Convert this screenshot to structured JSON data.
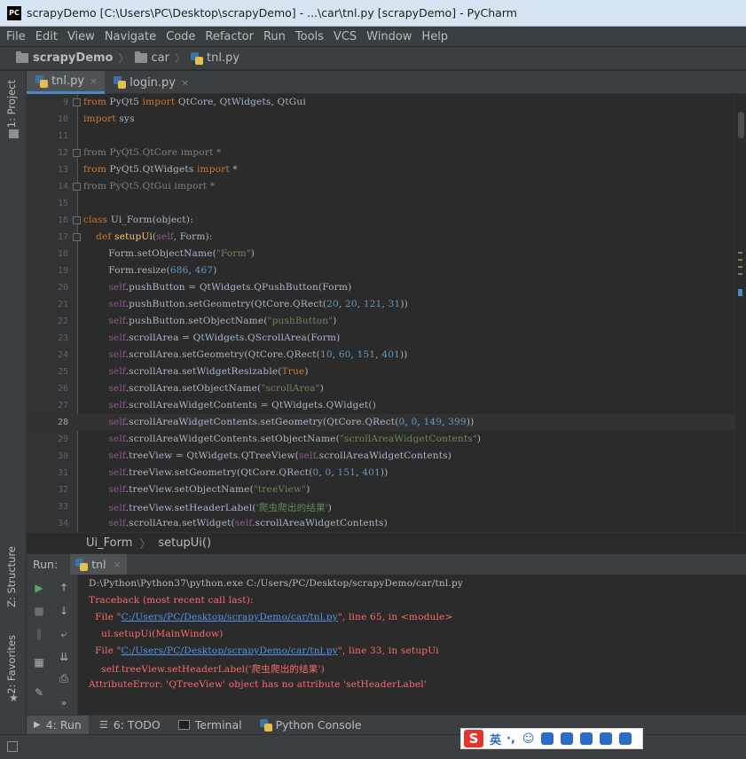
{
  "window": {
    "app_icon": "PC",
    "title": "scrapyDemo [C:\\Users\\PC\\Desktop\\scrapyDemo] - ...\\car\\tnl.py [scrapyDemo] - PyCharm"
  },
  "menu": [
    "File",
    "Edit",
    "View",
    "Navigate",
    "Code",
    "Refactor",
    "Run",
    "Tools",
    "VCS",
    "Window",
    "Help"
  ],
  "breadcrumb": {
    "project": "scrapyDemo",
    "folder": "car",
    "file": "tnl.py"
  },
  "left_strip": {
    "project_tab": "1: Project",
    "structure_tab": "Z: Structure",
    "favorites_tab": "2: Favorites"
  },
  "editor_tabs": [
    {
      "label": "tnl.py",
      "close": "×",
      "active": true
    },
    {
      "label": "login.py",
      "close": "×",
      "active": false
    }
  ],
  "editor": {
    "current_line": 28,
    "lines": [
      {
        "n": "9",
        "tokens": [
          [
            "kw",
            "from "
          ],
          [
            "t",
            "PyQt5 "
          ],
          [
            "kw",
            "import "
          ],
          [
            "t",
            "QtCore, QtWidgets, QtGui"
          ]
        ]
      },
      {
        "n": "10",
        "tokens": [
          [
            "kw",
            "import "
          ],
          [
            "t",
            "sys"
          ]
        ]
      },
      {
        "n": "11",
        "tokens": []
      },
      {
        "n": "12",
        "tokens": [
          [
            "gray",
            "from PyQt5.QtCore import *"
          ]
        ]
      },
      {
        "n": "13",
        "tokens": [
          [
            "kw",
            "from "
          ],
          [
            "t",
            "PyQt5.QtWidgets "
          ],
          [
            "kw",
            "import "
          ],
          [
            "t",
            "*"
          ]
        ]
      },
      {
        "n": "14",
        "tokens": [
          [
            "gray",
            "from PyQt5.QtGui import *"
          ]
        ]
      },
      {
        "n": "15",
        "tokens": []
      },
      {
        "n": "16",
        "tokens": [
          [
            "kw",
            "class "
          ],
          [
            "t",
            "Ui_Form(object):"
          ]
        ]
      },
      {
        "n": "17",
        "tokens": [
          [
            "t",
            "    "
          ],
          [
            "kw",
            "def "
          ],
          [
            "fn",
            "setupUi"
          ],
          [
            "t",
            "("
          ],
          [
            "self",
            "self"
          ],
          [
            "t",
            ", Form):"
          ]
        ]
      },
      {
        "n": "18",
        "tokens": [
          [
            "t",
            "        Form.setObjectName("
          ],
          [
            "str",
            "\"Form\""
          ],
          [
            "t",
            ")"
          ]
        ]
      },
      {
        "n": "19",
        "tokens": [
          [
            "t",
            "        Form.resize("
          ],
          [
            "num",
            "686"
          ],
          [
            "t",
            ", "
          ],
          [
            "num",
            "467"
          ],
          [
            "t",
            ")"
          ]
        ]
      },
      {
        "n": "20",
        "tokens": [
          [
            "t",
            "        "
          ],
          [
            "self",
            "self"
          ],
          [
            "t",
            ".pushButton = QtWidgets.QPushButton(Form)"
          ]
        ]
      },
      {
        "n": "21",
        "tokens": [
          [
            "t",
            "        "
          ],
          [
            "self",
            "self"
          ],
          [
            "t",
            ".pushButton.setGeometry(QtCore.QRect("
          ],
          [
            "num",
            "20"
          ],
          [
            "t",
            ", "
          ],
          [
            "num",
            "20"
          ],
          [
            "t",
            ", "
          ],
          [
            "num",
            "121"
          ],
          [
            "t",
            ", "
          ],
          [
            "num",
            "31"
          ],
          [
            "t",
            "))"
          ]
        ]
      },
      {
        "n": "22",
        "tokens": [
          [
            "t",
            "        "
          ],
          [
            "self",
            "self"
          ],
          [
            "t",
            ".pushButton.setObjectName("
          ],
          [
            "str",
            "\"pushButton\""
          ],
          [
            "t",
            ")"
          ]
        ]
      },
      {
        "n": "23",
        "tokens": [
          [
            "t",
            "        "
          ],
          [
            "self",
            "self"
          ],
          [
            "t",
            ".scrollArea = QtWidgets.QScrollArea(Form)"
          ]
        ]
      },
      {
        "n": "24",
        "tokens": [
          [
            "t",
            "        "
          ],
          [
            "self",
            "self"
          ],
          [
            "t",
            ".scrollArea.setGeometry(QtCore.QRect("
          ],
          [
            "num",
            "10"
          ],
          [
            "t",
            ", "
          ],
          [
            "num",
            "60"
          ],
          [
            "t",
            ", "
          ],
          [
            "num",
            "151"
          ],
          [
            "t",
            ", "
          ],
          [
            "num",
            "401"
          ],
          [
            "t",
            "))"
          ]
        ]
      },
      {
        "n": "25",
        "tokens": [
          [
            "t",
            "        "
          ],
          [
            "self",
            "self"
          ],
          [
            "t",
            ".scrollArea.setWidgetResizable("
          ],
          [
            "kw",
            "True"
          ],
          [
            "t",
            ")"
          ]
        ]
      },
      {
        "n": "26",
        "tokens": [
          [
            "t",
            "        "
          ],
          [
            "self",
            "self"
          ],
          [
            "t",
            ".scrollArea.setObjectName("
          ],
          [
            "str",
            "\"scrollArea\""
          ],
          [
            "t",
            ")"
          ]
        ]
      },
      {
        "n": "27",
        "tokens": [
          [
            "t",
            "        "
          ],
          [
            "self",
            "self"
          ],
          [
            "t",
            ".scrollAreaWidgetContents = QtWidgets.QWidget()"
          ]
        ]
      },
      {
        "n": "28",
        "tokens": [
          [
            "t",
            "        "
          ],
          [
            "self",
            "self"
          ],
          [
            "t",
            ".scrollAreaWidgetContents.setGeometry(QtCore.QRect("
          ],
          [
            "num",
            "0"
          ],
          [
            "t",
            ", "
          ],
          [
            "num",
            "0"
          ],
          [
            "t",
            ", "
          ],
          [
            "num",
            "149"
          ],
          [
            "t",
            ", "
          ],
          [
            "num",
            "399"
          ],
          [
            "t",
            "))"
          ]
        ]
      },
      {
        "n": "29",
        "tokens": [
          [
            "t",
            "        "
          ],
          [
            "self",
            "self"
          ],
          [
            "t",
            ".scrollAreaWidgetContents.setObjectName("
          ],
          [
            "str",
            "\"scrollAreaWidgetContents\""
          ],
          [
            "t",
            ")"
          ]
        ]
      },
      {
        "n": "30",
        "tokens": [
          [
            "t",
            "        "
          ],
          [
            "self",
            "self"
          ],
          [
            "t",
            ".treeView = QtWidgets.QTreeView("
          ],
          [
            "self",
            "self"
          ],
          [
            "t",
            ".scrollAreaWidgetContents)"
          ]
        ]
      },
      {
        "n": "31",
        "tokens": [
          [
            "t",
            "        "
          ],
          [
            "self",
            "self"
          ],
          [
            "t",
            ".treeView.setGeometry(QtCore.QRect("
          ],
          [
            "num",
            "0"
          ],
          [
            "t",
            ", "
          ],
          [
            "num",
            "0"
          ],
          [
            "t",
            ", "
          ],
          [
            "num",
            "151"
          ],
          [
            "t",
            ", "
          ],
          [
            "num",
            "401"
          ],
          [
            "t",
            "))"
          ]
        ]
      },
      {
        "n": "32",
        "tokens": [
          [
            "t",
            "        "
          ],
          [
            "self",
            "self"
          ],
          [
            "t",
            ".treeView.setObjectName("
          ],
          [
            "str",
            "\"treeView\""
          ],
          [
            "t",
            ")"
          ]
        ]
      },
      {
        "n": "33",
        "tokens": [
          [
            "t",
            "        "
          ],
          [
            "self",
            "self"
          ],
          [
            "t",
            ".treeView.setHeaderLabel("
          ],
          [
            "str",
            "'爬虫爬出的结果'"
          ],
          [
            "t",
            ")"
          ]
        ]
      },
      {
        "n": "34",
        "tokens": [
          [
            "t",
            "        "
          ],
          [
            "self",
            "self"
          ],
          [
            "t",
            ".scrollArea.setWidget("
          ],
          [
            "self",
            "self"
          ],
          [
            "t",
            ".scrollAreaWidgetContents)"
          ]
        ]
      }
    ]
  },
  "code_breadcrumb": {
    "class_name": "Ui_Form",
    "method": "setupUi()"
  },
  "run_panel": {
    "label": "Run:",
    "tab": "tnl",
    "tab_close": "×",
    "output": [
      {
        "kind": "plain",
        "text": "D:\\Python\\Python37\\python.exe C:/Users/PC/Desktop/scrapyDemo/car/tnl.py"
      },
      {
        "kind": "err",
        "text": "Traceback (most recent call last):"
      },
      {
        "kind": "file",
        "pre": "  File \"",
        "link": "C:/Users/PC/Desktop/scrapyDemo/car/tnl.py",
        "post": "\", line 65, in <module>"
      },
      {
        "kind": "err",
        "text": "    ui.setupUi(MainWindow)"
      },
      {
        "kind": "file",
        "pre": "  File \"",
        "link": "C:/Users/PC/Desktop/scrapyDemo/car/tnl.py",
        "post": "\", line 33, in setupUi"
      },
      {
        "kind": "err",
        "text": "    self.treeView.setHeaderLabel('爬虫爬出的结果')"
      },
      {
        "kind": "err",
        "text": "AttributeError: 'QTreeView' object has no attribute 'setHeaderLabel'"
      }
    ]
  },
  "bottom_tabs": [
    {
      "label": "4: Run",
      "active": true
    },
    {
      "label": "6: TODO",
      "active": false
    },
    {
      "label": "Terminal",
      "active": false
    },
    {
      "label": "Python Console",
      "active": false
    }
  ],
  "ime": {
    "logo": "S",
    "mode": "英"
  },
  "colors": {
    "accent": "#4a88c7",
    "error": "#ff6b68",
    "link": "#5394ec",
    "keyword": "#cc7832",
    "string": "#6a8759",
    "number": "#6897bb"
  }
}
